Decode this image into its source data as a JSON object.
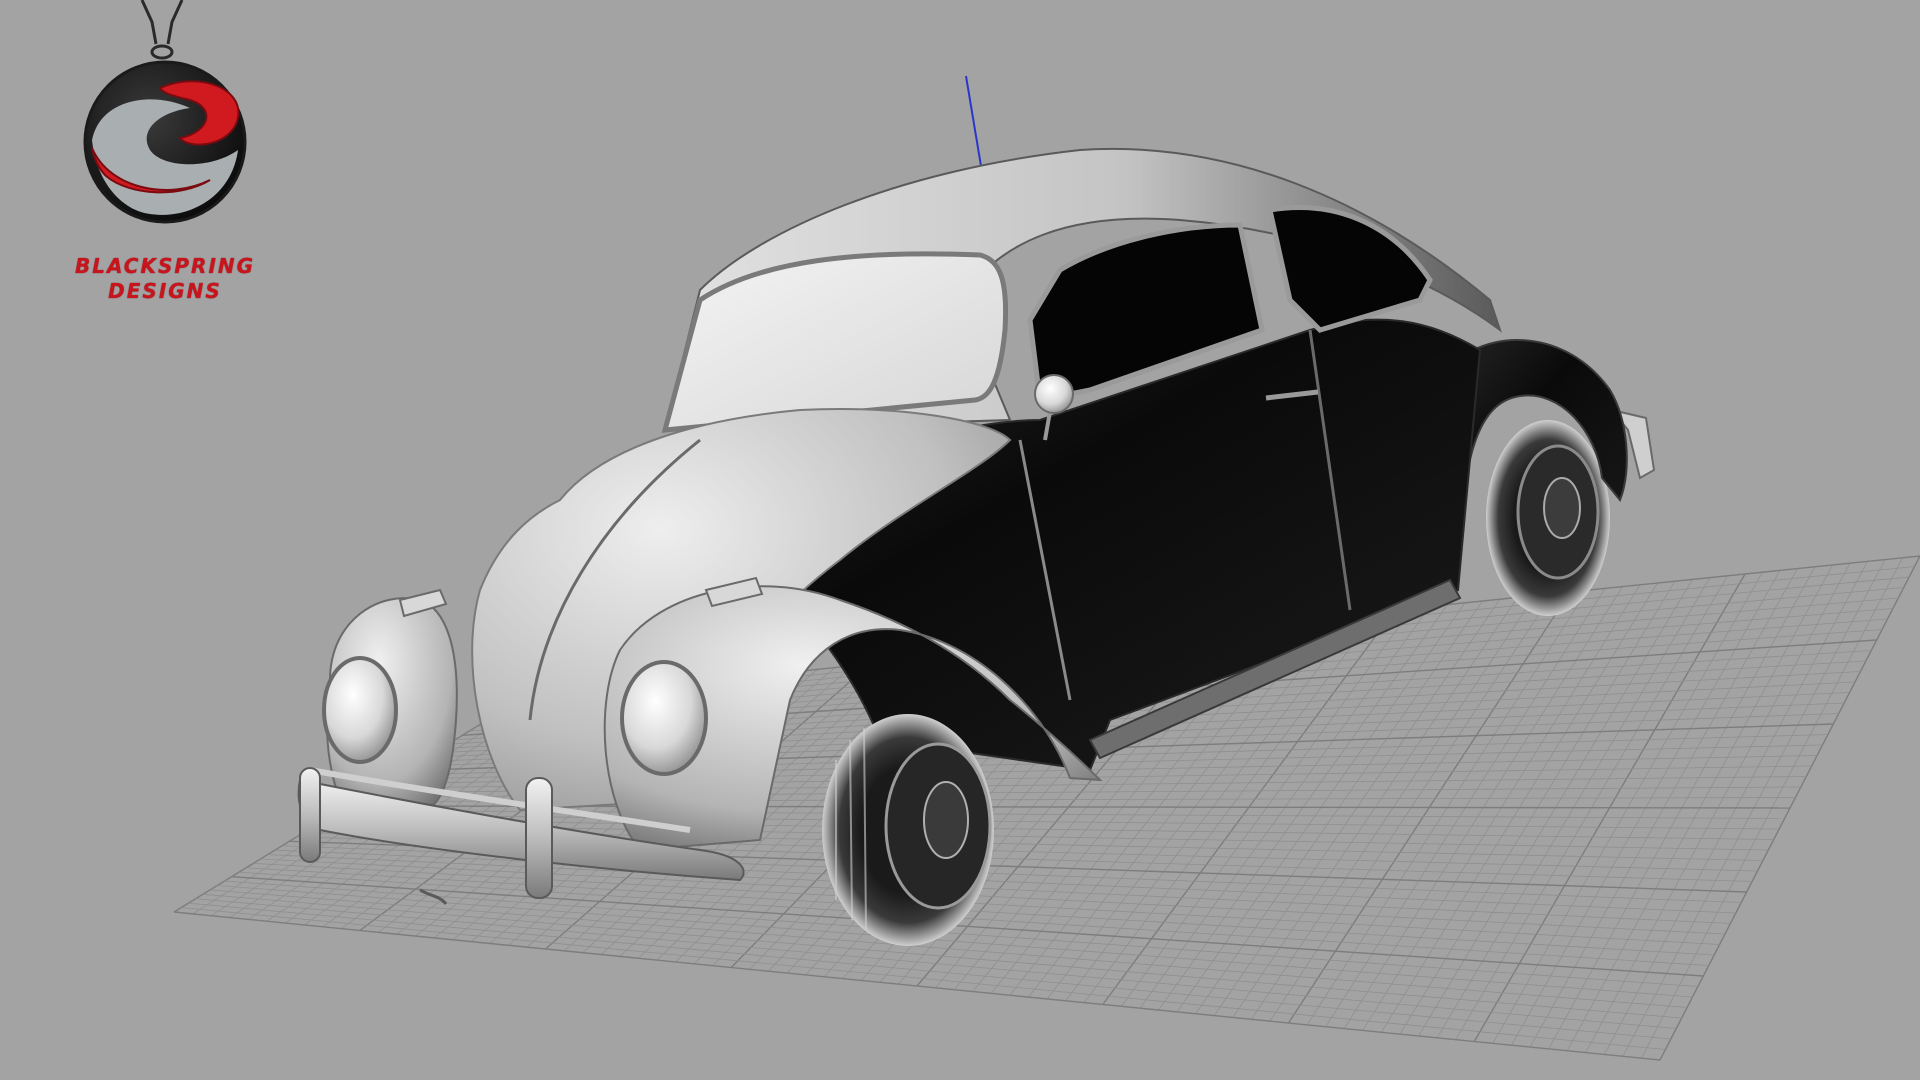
{
  "viewport": {
    "background": "#a3a3a3",
    "view": "perspective",
    "display_mode": "shaded"
  },
  "model": {
    "subject": "beetle-car",
    "body_color": "#0d0d0d",
    "panel_color": "#cfcfcf"
  },
  "grid": {
    "color": "#8f8f8f",
    "major_color": "#7d7d7d"
  },
  "axis": {
    "z_color": "#2a36c8"
  },
  "logo": {
    "icon": "blackspring-pendant-logo",
    "line1": "BLACKSPRING",
    "line2": "DESIGNS",
    "accent": "#c8141c"
  }
}
